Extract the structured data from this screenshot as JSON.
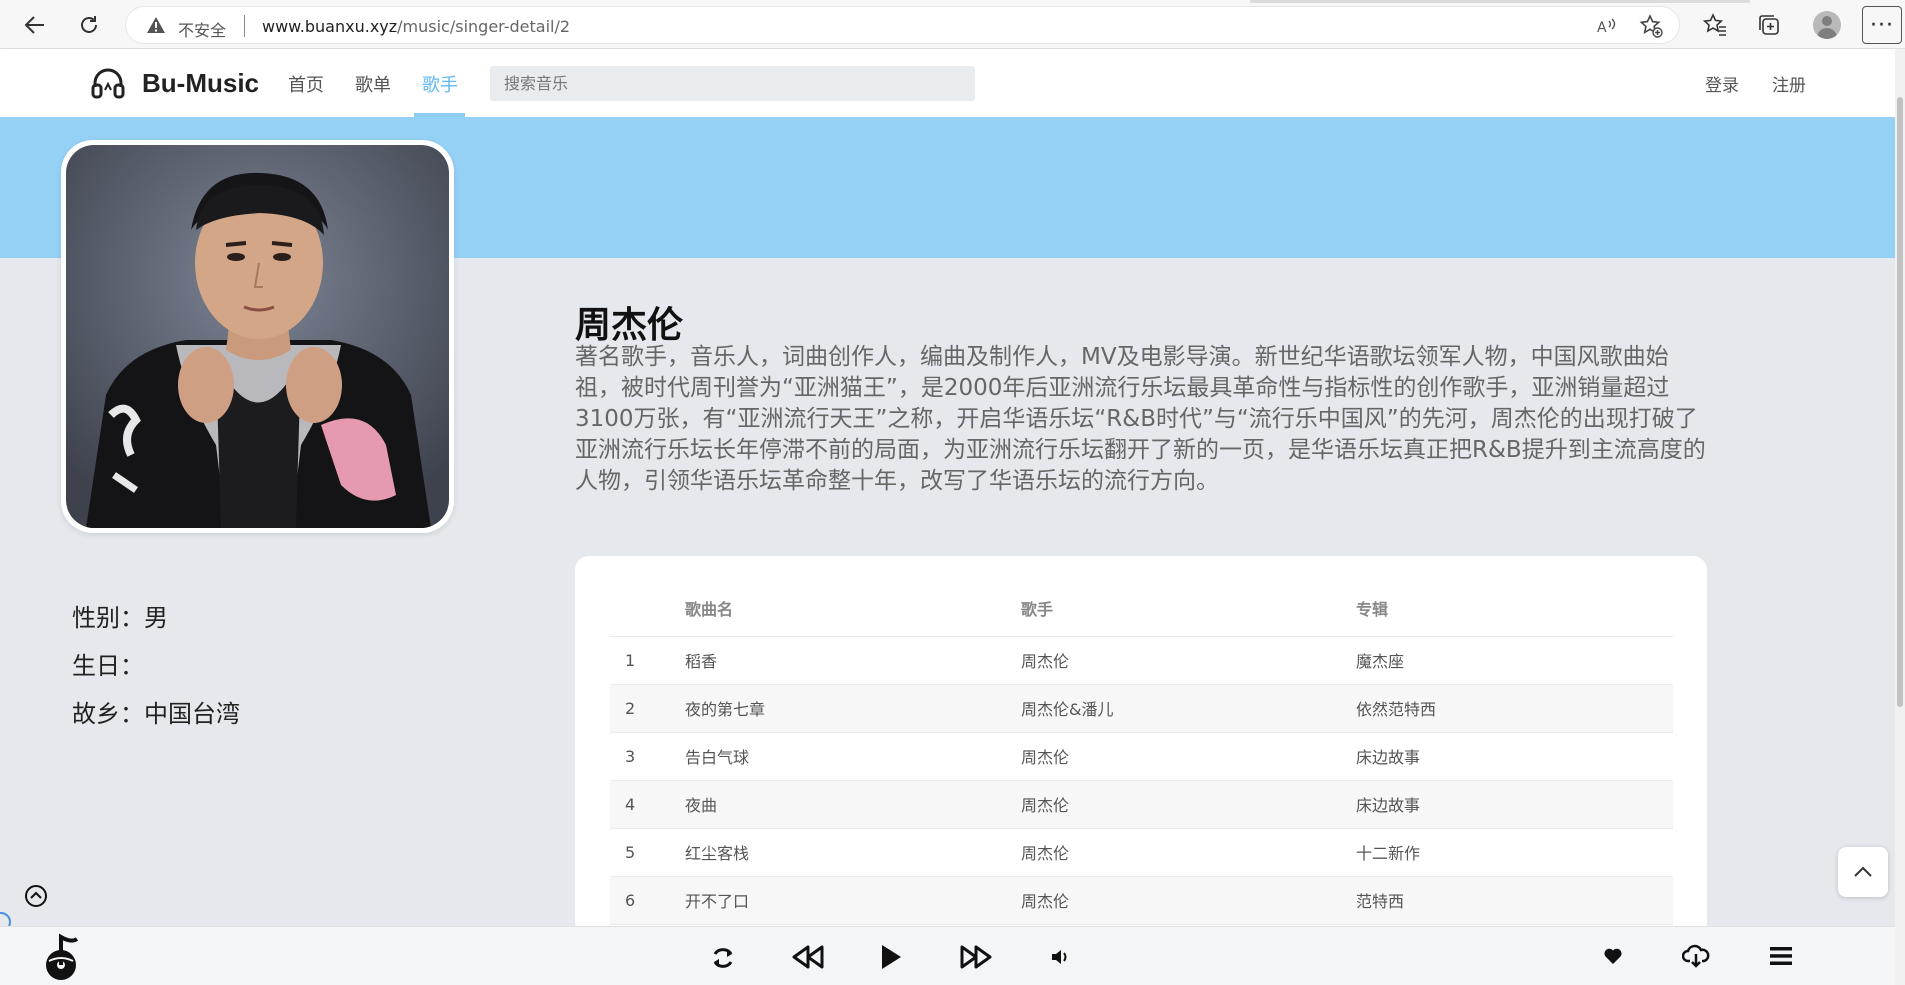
{
  "browser": {
    "insecure_label": "不安全",
    "url_host": "www.buanxu.xyz",
    "url_path": "/music/singer-detail/2"
  },
  "header": {
    "logo_text": "Bu-Music",
    "nav": [
      {
        "label": "首页",
        "active": false
      },
      {
        "label": "歌单",
        "active": false
      },
      {
        "label": "歌手",
        "active": true
      }
    ],
    "search_placeholder": "搜索音乐",
    "login_label": "登录",
    "register_label": "注册"
  },
  "colors": {
    "accent": "#61b8f0",
    "banner": "#95d1f5",
    "page_bg": "#e5e9ee"
  },
  "singer": {
    "name": "周杰伦",
    "intro": "著名歌手，音乐人，词曲创作人，编曲及制作人，MV及电影导演。新世纪华语歌坛领军人物，中国风歌曲始祖，被时代周刊誉为“亚洲猫王”，是2000年后亚洲流行乐坛最具革命性与指标性的创作歌手，亚洲销量超过3100万张，有“亚洲流行天王”之称，开启华语乐坛“R&B时代”与“流行乐中国风”的先河，周杰伦的出现打破了亚洲流行乐坛长年停滞不前的局面，为亚洲流行乐坛翻开了新的一页，是华语乐坛真正把R&B提升到主流高度的人物，引领华语乐坛革命整十年，改写了华语乐坛的流行方向。",
    "gender_label": "性别：",
    "gender": "男",
    "birthday_label": "生日：",
    "birthday": "",
    "hometown_label": "故乡：",
    "hometown": "中国台湾"
  },
  "songs": {
    "columns": [
      "",
      "歌曲名",
      "歌手",
      "专辑"
    ],
    "rows": [
      {
        "index": "1",
        "name": "稻香",
        "singer": "周杰伦",
        "album": "魔杰座"
      },
      {
        "index": "2",
        "name": "夜的第七章",
        "singer": "周杰伦&潘儿",
        "album": "依然范特西"
      },
      {
        "index": "3",
        "name": "告白气球",
        "singer": "周杰伦",
        "album": "床边故事"
      },
      {
        "index": "4",
        "name": "夜曲",
        "singer": "周杰伦",
        "album": "床边故事"
      },
      {
        "index": "5",
        "name": "红尘客栈",
        "singer": "周杰伦",
        "album": "十二新作"
      },
      {
        "index": "6",
        "name": "开不了口",
        "singer": "周杰伦",
        "album": "范特西"
      }
    ]
  },
  "icons": {
    "back": "arrow-left-icon",
    "refresh": "refresh-icon",
    "warning": "warning-icon",
    "read_aloud": "read-aloud-icon",
    "add_favorite": "star-plus-icon",
    "favorites": "favorites-icon",
    "collections": "collections-icon",
    "logo": "headphones-icon",
    "loop": "loop-icon",
    "prev": "skip-back-icon",
    "play": "play-icon",
    "next": "skip-forward-icon",
    "volume": "volume-icon",
    "like": "heart-icon",
    "download": "cloud-download-icon",
    "playlist": "list-icon",
    "back_to_top": "chevron-up-icon"
  }
}
